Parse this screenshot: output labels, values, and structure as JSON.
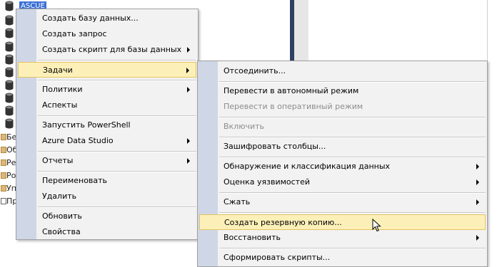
{
  "explorer": {
    "selected_node": "ASCUE",
    "folder_nodes": [
      "Бе",
      "Об",
      "Ре",
      "Ро",
      "Уп",
      "Пр"
    ]
  },
  "context_menu": {
    "items": [
      {
        "label": "Создать базу данных...",
        "submenu": false
      },
      {
        "label": "Создать запрос",
        "submenu": false
      },
      {
        "label": "Создать скрипт для базы данных",
        "submenu": true
      },
      {
        "label": "Задачи",
        "submenu": true,
        "highlighted": true
      },
      {
        "label": "Политики",
        "submenu": true
      },
      {
        "label": "Аспекты",
        "submenu": false
      },
      {
        "label": "Запустить PowerShell",
        "submenu": false
      },
      {
        "label": "Azure Data Studio",
        "submenu": true
      },
      {
        "label": "Отчеты",
        "submenu": true
      },
      {
        "label": "Переименовать",
        "submenu": false
      },
      {
        "label": "Удалить",
        "submenu": false
      },
      {
        "label": "Обновить",
        "submenu": false
      },
      {
        "label": "Свойства",
        "submenu": false
      }
    ]
  },
  "tasks_submenu": {
    "items": [
      {
        "label": "Отсоединить...",
        "enabled": true,
        "submenu": false
      },
      {
        "label": "Перевести в автономный режим",
        "enabled": true,
        "submenu": false
      },
      {
        "label": "Перевести в оперативный режим",
        "enabled": false,
        "submenu": false
      },
      {
        "label": "Включить",
        "enabled": false,
        "submenu": false
      },
      {
        "label": "Зашифровать столбцы...",
        "enabled": true,
        "submenu": false
      },
      {
        "label": "Обнаружение и классификация данных",
        "enabled": true,
        "submenu": true
      },
      {
        "label": "Оценка уязвимостей",
        "enabled": true,
        "submenu": true
      },
      {
        "label": "Сжать",
        "enabled": true,
        "submenu": true
      },
      {
        "label": "Создать резервную копию...",
        "enabled": true,
        "submenu": false,
        "highlighted": true
      },
      {
        "label": "Восстановить",
        "enabled": true,
        "submenu": true
      },
      {
        "label": "Сформировать скрипты...",
        "enabled": true,
        "submenu": false
      }
    ]
  },
  "colors": {
    "highlight": "#fcf0b8",
    "gutter": "#cfd6e5",
    "menu_bg": "#f2f2f2",
    "disabled_text": "#8d8d8d"
  }
}
